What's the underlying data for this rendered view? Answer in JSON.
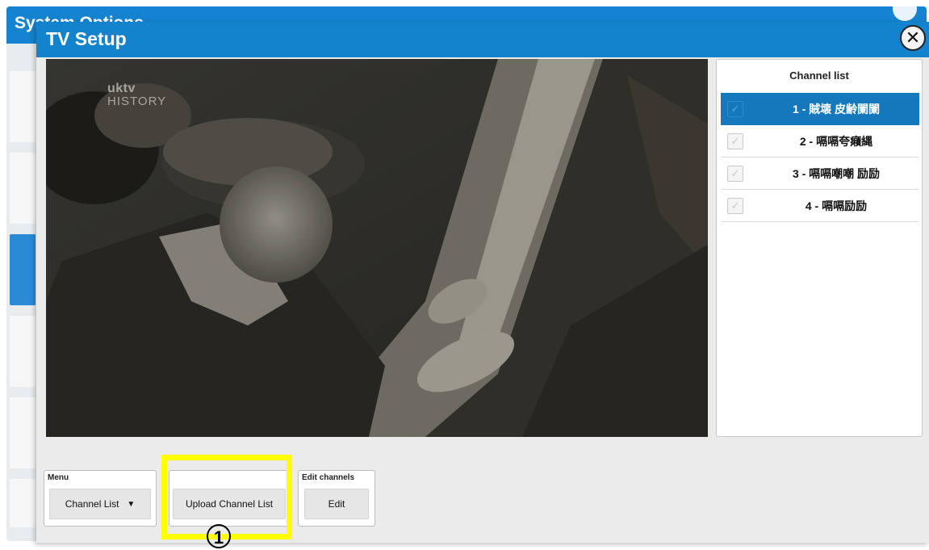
{
  "background_window": {
    "title": "System Options"
  },
  "dialog": {
    "title": "TV Setup",
    "close_icon": "close-icon"
  },
  "video": {
    "watermark_line1": "uktv",
    "watermark_line2": "HISTORY"
  },
  "channel_list": {
    "title": "Channel list",
    "items": [
      {
        "label": "1 - 賊壊 皮齢闌闌",
        "selected": true
      },
      {
        "label": "2 - 嗝嗝夸癪縄",
        "selected": false
      },
      {
        "label": "3 - 嗝嗝嘲嘲 励励",
        "selected": false
      },
      {
        "label": "4 - 嗝嗝励励",
        "selected": false
      }
    ]
  },
  "controls": {
    "menu_label": "Menu",
    "menu_value": "Channel List",
    "upload_label": "Upload Channel List",
    "edit_group_label": "Edit channels",
    "edit_label": "Edit"
  },
  "annotation": {
    "callout_number": "1",
    "highlight_color": "#ffff00"
  },
  "colors": {
    "header_blue": "#1483cd",
    "selected_blue": "#1578bd"
  }
}
